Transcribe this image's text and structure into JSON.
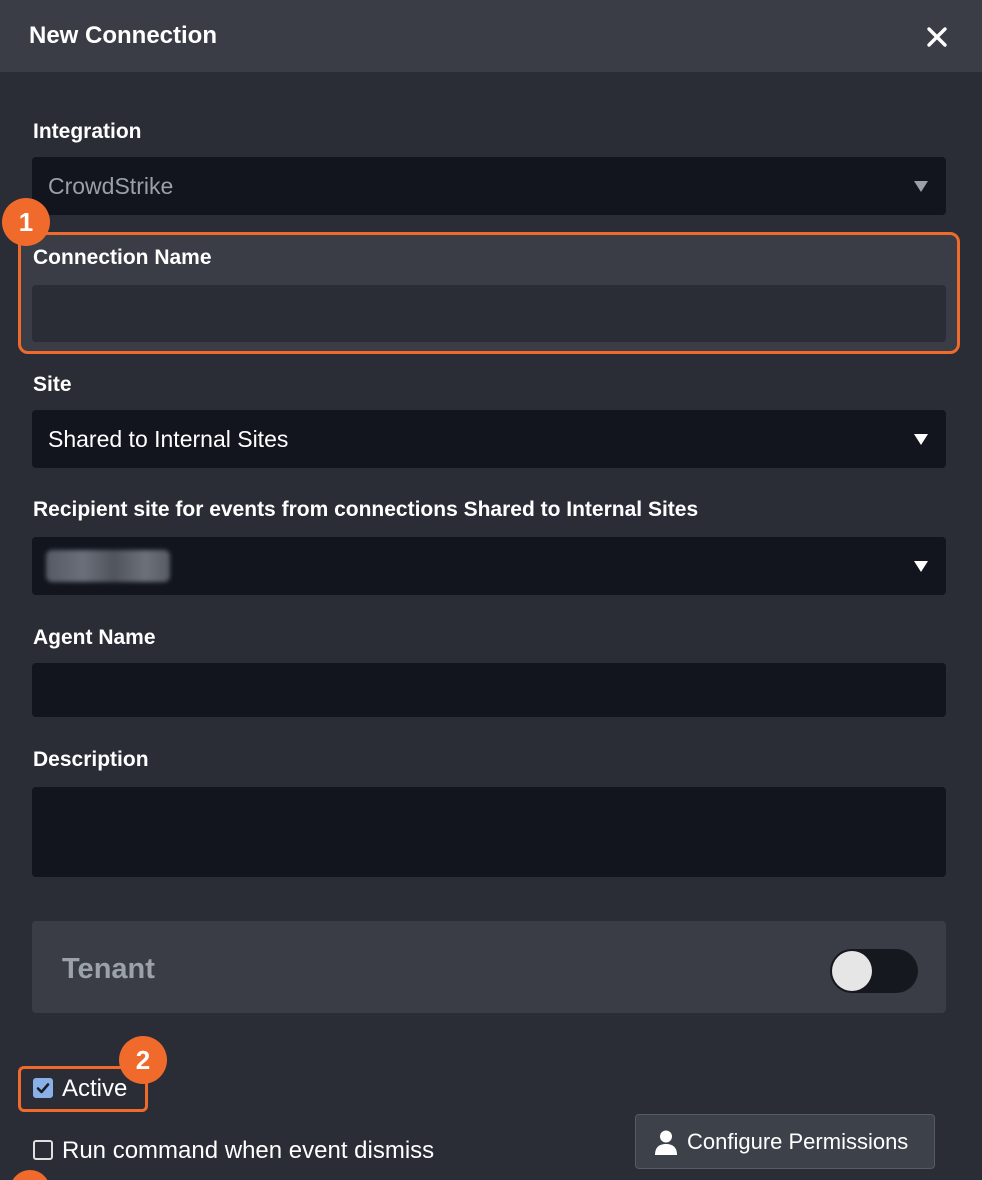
{
  "dialog": {
    "title": "New Connection"
  },
  "form": {
    "integration": {
      "label": "Integration",
      "value": "CrowdStrike"
    },
    "connection_name": {
      "label": "Connection Name",
      "value": ""
    },
    "site": {
      "label": "Site",
      "value": "Shared to Internal Sites"
    },
    "recipient_site": {
      "label": "Recipient site for events from connections Shared to Internal Sites"
    },
    "agent_name": {
      "label": "Agent Name",
      "value": ""
    },
    "description": {
      "label": "Description",
      "value": ""
    }
  },
  "tenant": {
    "label": "Tenant",
    "enabled": false
  },
  "options": {
    "active": {
      "label": "Active",
      "checked": true
    },
    "run_command": {
      "label": "Run command when event dismiss",
      "checked": false
    }
  },
  "buttons": {
    "configure_permissions": "Configure Permissions"
  },
  "annotations": {
    "badge_1": "1",
    "badge_2": "2"
  },
  "colors": {
    "accent": "#f06a2c",
    "background": "#2a2d35",
    "header": "#3a3d45",
    "field": "#12151e",
    "checkbox": "#8ab0e8"
  }
}
